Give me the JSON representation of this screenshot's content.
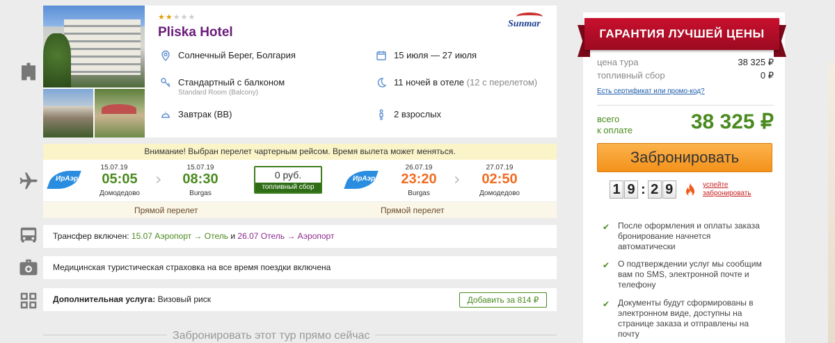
{
  "hotel": {
    "stars_filled": 2,
    "stars_total": 5,
    "name": "Pliska Hotel",
    "operator_logo": "Sunmar",
    "location": "Солнечный Берег, Болгария",
    "dates": "15 июля — 27 июля",
    "room": "Стандартный с балконом",
    "room_sub": "Standard Room (Balcony)",
    "nights": "11 ночей в отеле",
    "nights_extra": "(12 с перелетом)",
    "meal": "Завтрак (BB)",
    "guests": "2 взрослых"
  },
  "flight": {
    "warning": "Внимание! Выбран перелет чартерным рейсом. Время вылета может меняться.",
    "airline_logo": "ИрАэро",
    "outbound": {
      "dep_date": "15.07.19",
      "dep_time": "05:05",
      "dep_place": "Домодедово",
      "arr_date": "15.07.19",
      "arr_time": "08:30",
      "arr_place": "Burgas",
      "label": "Прямой перелет"
    },
    "fuel": {
      "value": "0 руб.",
      "label": "топливный сбор"
    },
    "inbound": {
      "dep_date": "26.07.19",
      "dep_time": "23:20",
      "dep_place": "Burgas",
      "arr_date": "27.07.19",
      "arr_time": "02:50",
      "arr_place": "Домодедово",
      "label": "Прямой перелет"
    }
  },
  "transfer": {
    "prefix": "Трансфер включен:",
    "first": "15.07 Аэропорт → Отель",
    "and": "и",
    "second": "26.07 Отель → Аэропорт"
  },
  "insurance": {
    "text": "Медицинская туристическая страховка на все время поездки включена"
  },
  "extra": {
    "prefix": "Дополнительная услуга:",
    "name": "Визовый риск",
    "button": "Добавить за 814 ₽"
  },
  "book_now_hint": "Забронировать этот тур прямо сейчас",
  "panel": {
    "banner": "ГАРАНТИЯ ЛУЧШЕЙ ЦЕНЫ",
    "tour_price_label": "цена тура",
    "tour_price": "38 325 ₽",
    "fuel_label": "топливный сбор",
    "fuel_price": "0 ₽",
    "promo_link": "Есть сертификат или промо-код?",
    "total_label_1": "всего",
    "total_label_2": "к оплате",
    "total": "38 325 ₽",
    "book_button": "Забронировать",
    "timer": [
      "1",
      "9",
      "2",
      "9"
    ],
    "hurry_1": "успейте",
    "hurry_2": "забронировать",
    "bullets": [
      "После оформления и оплаты заказа бронирование начнется автоматически",
      "О подтверждении услуг мы сообщим вам по SMS, электронной почте и телефону",
      "Документы будут сформированы в электронном виде, доступны на странице заказа и отправлены на почту"
    ]
  },
  "colors": {
    "hotel_name": "#6a1b7a",
    "accent_green": "#4a8a1e",
    "time_orange": "#f26b1f",
    "banner_red": "#c8102e",
    "book_orange": "#f4921a"
  }
}
